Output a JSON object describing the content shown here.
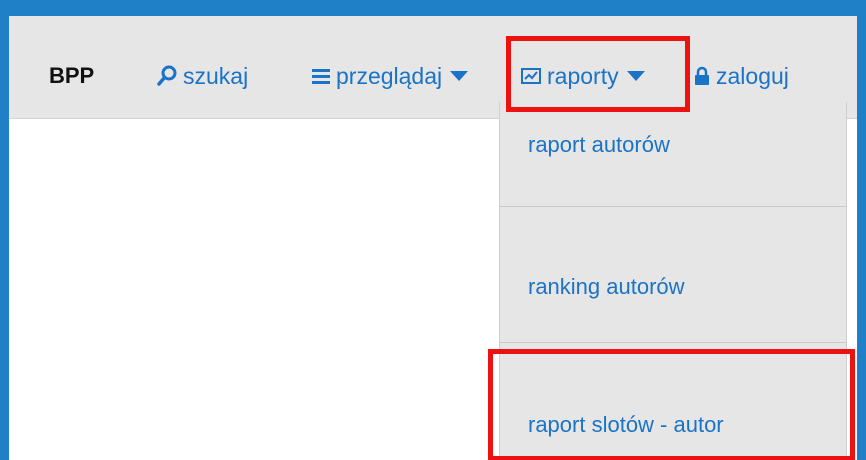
{
  "navbar": {
    "brand": "BPP",
    "search": {
      "label": "szukaj",
      "icon": "search-icon"
    },
    "browse": {
      "label": "przeglądaj",
      "icon": "list-icon"
    },
    "reports": {
      "label": "raporty",
      "icon": "chart-icon"
    },
    "login": {
      "label": "zaloguj",
      "icon": "lock-icon"
    }
  },
  "reports_menu": {
    "items": [
      {
        "label": "raport autorów"
      },
      {
        "label": "ranking autorów"
      },
      {
        "label": "raport slotów - autor"
      }
    ]
  },
  "colors": {
    "frame": "#1f7fc7",
    "navbar_bg": "#e6e6e6",
    "link": "#1a73c7",
    "highlight": "#ee1111"
  }
}
